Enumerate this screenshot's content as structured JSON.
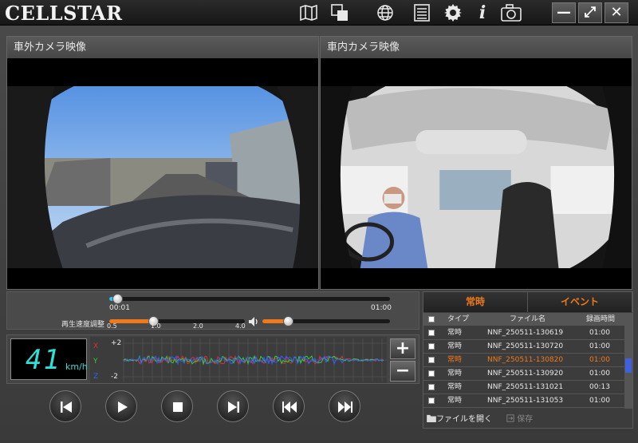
{
  "app": {
    "logo": "CELLSTAR"
  },
  "toolbar": {
    "icons": [
      "map-icon",
      "window-icon",
      "globe-icon",
      "list-icon",
      "gear-icon",
      "info-icon",
      "camera-icon"
    ],
    "info_glyph": "i"
  },
  "window": {
    "minimize": "—",
    "maximize": "⤢",
    "close": "✕"
  },
  "cameras": {
    "front_title": "車外カメラ映像",
    "rear_title": "車内カメラ映像"
  },
  "playback": {
    "current_time": "00:01",
    "total_time": "01:00",
    "progress": 0.02,
    "speed_label": "再生速度調整",
    "speed_ticks": [
      "0.5",
      "1.0",
      "2.0",
      "4.0"
    ],
    "speed_value": "1.0",
    "volume": 0.2
  },
  "speed": {
    "value": "41",
    "unit": "km/h"
  },
  "gsensor": {
    "x_label": "X",
    "y_label": "Y",
    "z_label": "Z",
    "max": "+2",
    "min": "-2",
    "colors": {
      "x": "#e03030",
      "y": "#30d030",
      "z": "#3060ff"
    }
  },
  "zoom": {
    "in": "+",
    "out": "−"
  },
  "transport": [
    "skip-back-icon",
    "play-icon",
    "stop-icon",
    "skip-forward-icon",
    "rewind-icon",
    "fast-forward-icon"
  ],
  "file_list": {
    "tabs": [
      "常時",
      "イベント"
    ],
    "columns": [
      "タイプ",
      "ファイル名",
      "録画時間"
    ],
    "rows": [
      {
        "type": "常時",
        "name": "NNF_250511-130619",
        "duration": "01:00"
      },
      {
        "type": "常時",
        "name": "NNF_250511-130720",
        "duration": "01:00"
      },
      {
        "type": "常時",
        "name": "NNF_250511-130820",
        "duration": "01:00"
      },
      {
        "type": "常時",
        "name": "NNF_250511-130920",
        "duration": "01:00"
      },
      {
        "type": "常時",
        "name": "NNF_250511-131021",
        "duration": "00:13"
      },
      {
        "type": "常時",
        "name": "NNF_250511-131053",
        "duration": "01:00"
      }
    ],
    "selected_row": 2,
    "open_button": "ファイルを開く",
    "save_button": "保存"
  }
}
